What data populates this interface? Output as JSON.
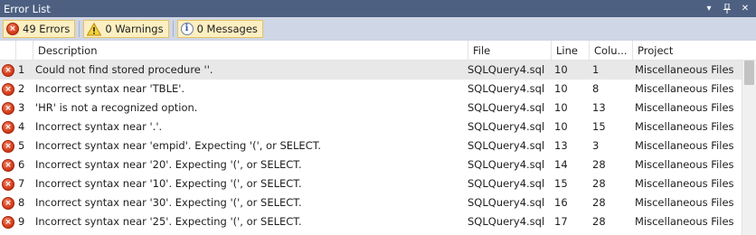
{
  "window": {
    "title": "Error List",
    "dropdown_glyph": "▾",
    "pin_glyph": "⊥",
    "close_glyph": "✕"
  },
  "toolbar": {
    "errors_label": "49 Errors",
    "warnings_label": "0 Warnings",
    "messages_label": "0 Messages"
  },
  "columns": {
    "description": "Description",
    "file": "File",
    "line": "Line",
    "column": "Colu...",
    "project": "Project"
  },
  "rows": [
    {
      "n": "1",
      "description": "Could not find stored procedure ''.",
      "file": "SQLQuery4.sql",
      "line": "10",
      "column": "1",
      "project": "Miscellaneous Files"
    },
    {
      "n": "2",
      "description": "Incorrect syntax near 'TBLE'.",
      "file": "SQLQuery4.sql",
      "line": "10",
      "column": "8",
      "project": "Miscellaneous Files"
    },
    {
      "n": "3",
      "description": "'HR' is not a recognized option.",
      "file": "SQLQuery4.sql",
      "line": "10",
      "column": "13",
      "project": "Miscellaneous Files"
    },
    {
      "n": "4",
      "description": "Incorrect syntax near '.'.",
      "file": "SQLQuery4.sql",
      "line": "10",
      "column": "15",
      "project": "Miscellaneous Files"
    },
    {
      "n": "5",
      "description": "Incorrect syntax near 'empid'.  Expecting '(', or SELECT.",
      "file": "SQLQuery4.sql",
      "line": "13",
      "column": "3",
      "project": "Miscellaneous Files"
    },
    {
      "n": "6",
      "description": "Incorrect syntax near '20'.  Expecting '(', or SELECT.",
      "file": "SQLQuery4.sql",
      "line": "14",
      "column": "28",
      "project": "Miscellaneous Files"
    },
    {
      "n": "7",
      "description": "Incorrect syntax near '10'.  Expecting '(', or SELECT.",
      "file": "SQLQuery4.sql",
      "line": "15",
      "column": "28",
      "project": "Miscellaneous Files"
    },
    {
      "n": "8",
      "description": "Incorrect syntax near '30'.  Expecting '(', or SELECT.",
      "file": "SQLQuery4.sql",
      "line": "16",
      "column": "28",
      "project": "Miscellaneous Files"
    },
    {
      "n": "9",
      "description": "Incorrect syntax near '25'.  Expecting '(', or SELECT.",
      "file": "SQLQuery4.sql",
      "line": "17",
      "column": "28",
      "project": "Miscellaneous Files"
    }
  ],
  "colors": {
    "titlebar": "#4d6082",
    "toolbar": "#cfd6e5",
    "filter_button": "#fcefc1",
    "selected_row": "#e8e8e8",
    "error_icon": "#d8411f"
  }
}
